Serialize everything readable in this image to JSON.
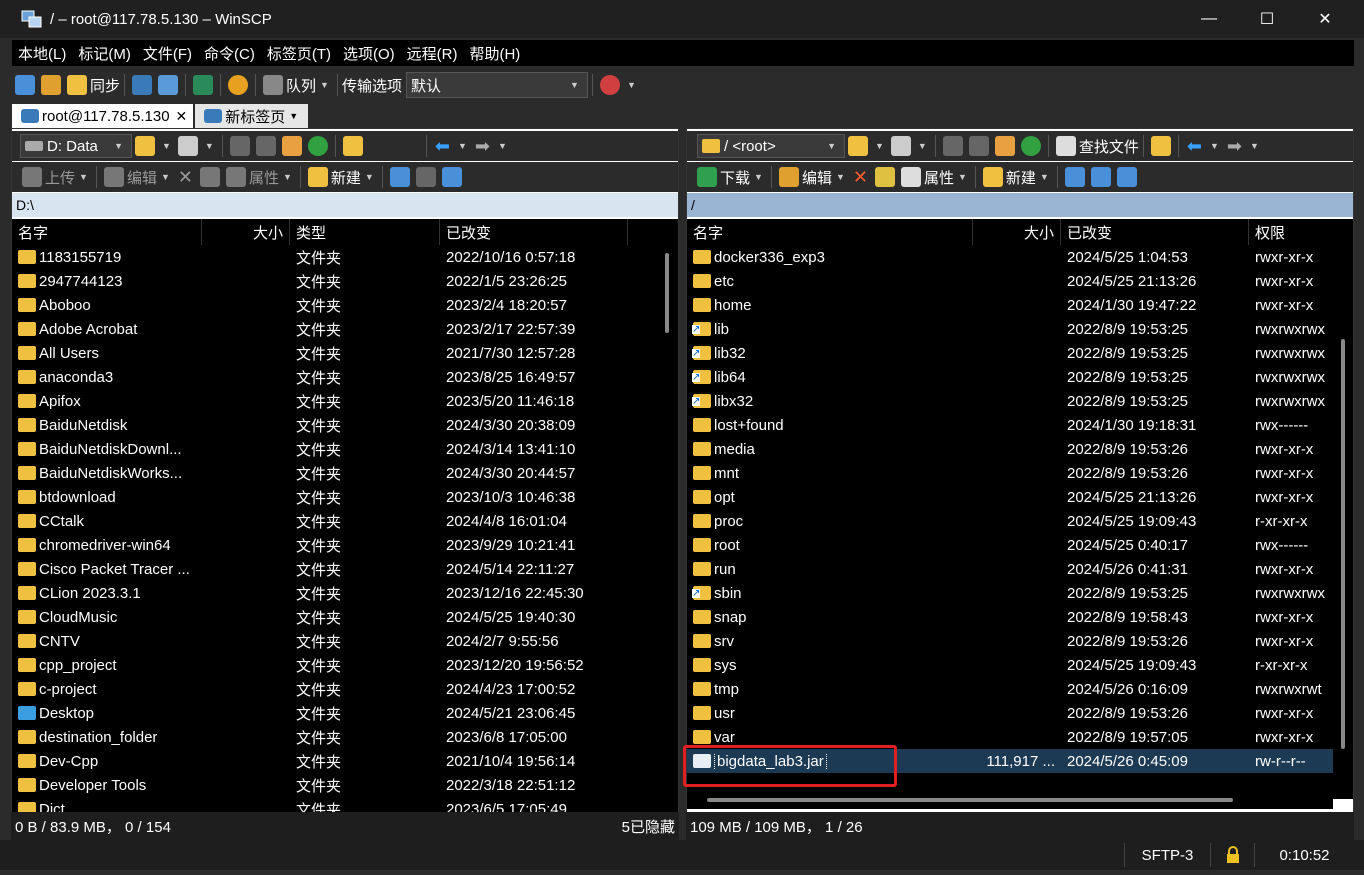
{
  "window": {
    "title": "/ – root@117.78.5.130 – WinSCP"
  },
  "menu": [
    "本地(L)",
    "标记(M)",
    "文件(F)",
    "命令(C)",
    "标签页(T)",
    "选项(O)",
    "远程(R)",
    "帮助(H)"
  ],
  "toolbar": {
    "sync_label": "同步",
    "queue_label": "队列",
    "transfer_label": "传输选项",
    "transfer_value": "默认"
  },
  "tabs": [
    {
      "label": "root@117.78.5.130"
    },
    {
      "label": "新标签页"
    }
  ],
  "local": {
    "drive": "D: Data",
    "upload": "上传",
    "edit": "编辑",
    "props": "属性",
    "new": "新建",
    "path": "D:\\",
    "columns": [
      "名字",
      "大小",
      "类型",
      "已改变"
    ],
    "rows": [
      [
        "1183155719",
        "",
        "文件夹",
        "2022/10/16 0:57:18"
      ],
      [
        "2947744123",
        "",
        "文件夹",
        "2022/1/5 23:26:25"
      ],
      [
        "Aboboo",
        "",
        "文件夹",
        "2023/2/4 18:20:57"
      ],
      [
        "Adobe Acrobat",
        "",
        "文件夹",
        "2023/2/17 22:57:39"
      ],
      [
        "All Users",
        "",
        "文件夹",
        "2021/7/30 12:57:28"
      ],
      [
        "anaconda3",
        "",
        "文件夹",
        "2023/8/25 16:49:57"
      ],
      [
        "Apifox",
        "",
        "文件夹",
        "2023/5/20 11:46:18"
      ],
      [
        "BaiduNetdisk",
        "",
        "文件夹",
        "2024/3/30 20:38:09"
      ],
      [
        "BaiduNetdiskDownl...",
        "",
        "文件夹",
        "2024/3/14 13:41:10"
      ],
      [
        "BaiduNetdiskWorks...",
        "",
        "文件夹",
        "2024/3/30 20:44:57"
      ],
      [
        "btdownload",
        "",
        "文件夹",
        "2023/10/3 10:46:38"
      ],
      [
        "CCtalk",
        "",
        "文件夹",
        "2024/4/8 16:01:04"
      ],
      [
        "chromedriver-win64",
        "",
        "文件夹",
        "2023/9/29 10:21:41"
      ],
      [
        "Cisco Packet Tracer ...",
        "",
        "文件夹",
        "2024/5/14 22:11:27"
      ],
      [
        "CLion 2023.3.1",
        "",
        "文件夹",
        "2023/12/16 22:45:30"
      ],
      [
        "CloudMusic",
        "",
        "文件夹",
        "2024/5/25 19:40:30"
      ],
      [
        "CNTV",
        "",
        "文件夹",
        "2024/2/7 9:55:56"
      ],
      [
        "cpp_project",
        "",
        "文件夹",
        "2023/12/20 19:56:52"
      ],
      [
        "c-project",
        "",
        "文件夹",
        "2024/4/23 17:00:52"
      ],
      [
        "Desktop",
        "",
        "文件夹",
        "2024/5/21 23:06:45"
      ],
      [
        "destination_folder",
        "",
        "文件夹",
        "2023/6/8 17:05:00"
      ],
      [
        "Dev-Cpp",
        "",
        "文件夹",
        "2021/10/4 19:56:14"
      ],
      [
        "Developer Tools",
        "",
        "文件夹",
        "2022/3/18 22:51:12"
      ],
      [
        "Dict",
        "",
        "文件夹",
        "2023/6/5 17:05:49"
      ]
    ],
    "status_left": "0 B / 83.9 MB， 0 / 154",
    "status_right": "5已隐藏"
  },
  "remote": {
    "dir": "/ <root>",
    "find": "查找文件",
    "download": "下载",
    "edit": "编辑",
    "props": "属性",
    "new": "新建",
    "path": "/",
    "columns": [
      "名字",
      "大小",
      "已改变",
      "权限"
    ],
    "rows": [
      [
        "docker336_exp3",
        "",
        "2024/5/25 1:04:53",
        "rwxr-xr-x"
      ],
      [
        "etc",
        "",
        "2024/5/25 21:13:26",
        "rwxr-xr-x"
      ],
      [
        "home",
        "",
        "2024/1/30 19:47:22",
        "rwxr-xr-x"
      ],
      [
        "lib",
        "",
        "2022/8/9 19:53:25",
        "rwxrwxrwx"
      ],
      [
        "lib32",
        "",
        "2022/8/9 19:53:25",
        "rwxrwxrwx"
      ],
      [
        "lib64",
        "",
        "2022/8/9 19:53:25",
        "rwxrwxrwx"
      ],
      [
        "libx32",
        "",
        "2022/8/9 19:53:25",
        "rwxrwxrwx"
      ],
      [
        "lost+found",
        "",
        "2024/1/30 19:18:31",
        "rwx------"
      ],
      [
        "media",
        "",
        "2022/8/9 19:53:26",
        "rwxr-xr-x"
      ],
      [
        "mnt",
        "",
        "2022/8/9 19:53:26",
        "rwxr-xr-x"
      ],
      [
        "opt",
        "",
        "2024/5/25 21:13:26",
        "rwxr-xr-x"
      ],
      [
        "proc",
        "",
        "2024/5/25 19:09:43",
        "r-xr-xr-x"
      ],
      [
        "root",
        "",
        "2024/5/25 0:40:17",
        "rwx------"
      ],
      [
        "run",
        "",
        "2024/5/26 0:41:31",
        "rwxr-xr-x"
      ],
      [
        "sbin",
        "",
        "2022/8/9 19:53:25",
        "rwxrwxrwx"
      ],
      [
        "snap",
        "",
        "2022/8/9 19:58:43",
        "rwxr-xr-x"
      ],
      [
        "srv",
        "",
        "2022/8/9 19:53:26",
        "rwxr-xr-x"
      ],
      [
        "sys",
        "",
        "2024/5/25 19:09:43",
        "r-xr-xr-x"
      ],
      [
        "tmp",
        "",
        "2024/5/26 0:16:09",
        "rwxrwxrwt"
      ],
      [
        "usr",
        "",
        "2022/8/9 19:53:26",
        "rwxr-xr-x"
      ],
      [
        "var",
        "",
        "2022/8/9 19:57:05",
        "rwxr-xr-x"
      ],
      [
        "bigdata_lab3.jar",
        "111,917 ...",
        "2024/5/26 0:45:09",
        "rw-r--r--"
      ]
    ],
    "status": "109 MB / 109 MB， 1 / 26"
  },
  "bottom": {
    "protocol": "SFTP-3",
    "time": "0:10:52"
  },
  "colors": {
    "highlight": "#e02020",
    "selected": "#1d3a55",
    "pathbar_remote": "#9ab4d4"
  }
}
